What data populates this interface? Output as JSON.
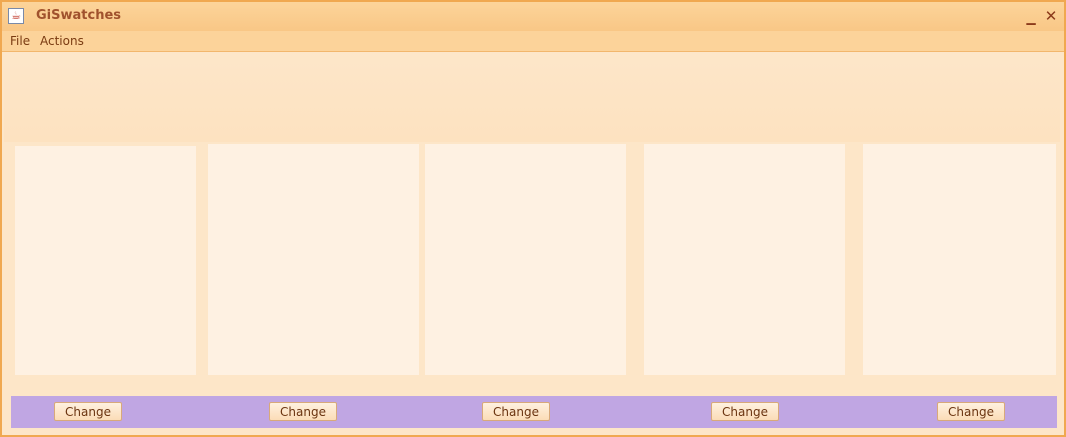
{
  "window": {
    "title": "GiSwatches",
    "app_icon": "java-cup-icon",
    "minimize_glyph": "▁",
    "close_glyph": "✕"
  },
  "menu": {
    "items": [
      {
        "label": "File"
      },
      {
        "label": "Actions"
      }
    ]
  },
  "swatches": [
    {
      "button_label": "Change"
    },
    {
      "button_label": "Change"
    },
    {
      "button_label": "Change"
    },
    {
      "button_label": "Change"
    },
    {
      "button_label": "Change"
    }
  ],
  "colors": {
    "titlebar": "#f9c786",
    "panel": "#fde6c8",
    "swatch": "#fef1e2",
    "button_bar": "#c0a6e3"
  }
}
